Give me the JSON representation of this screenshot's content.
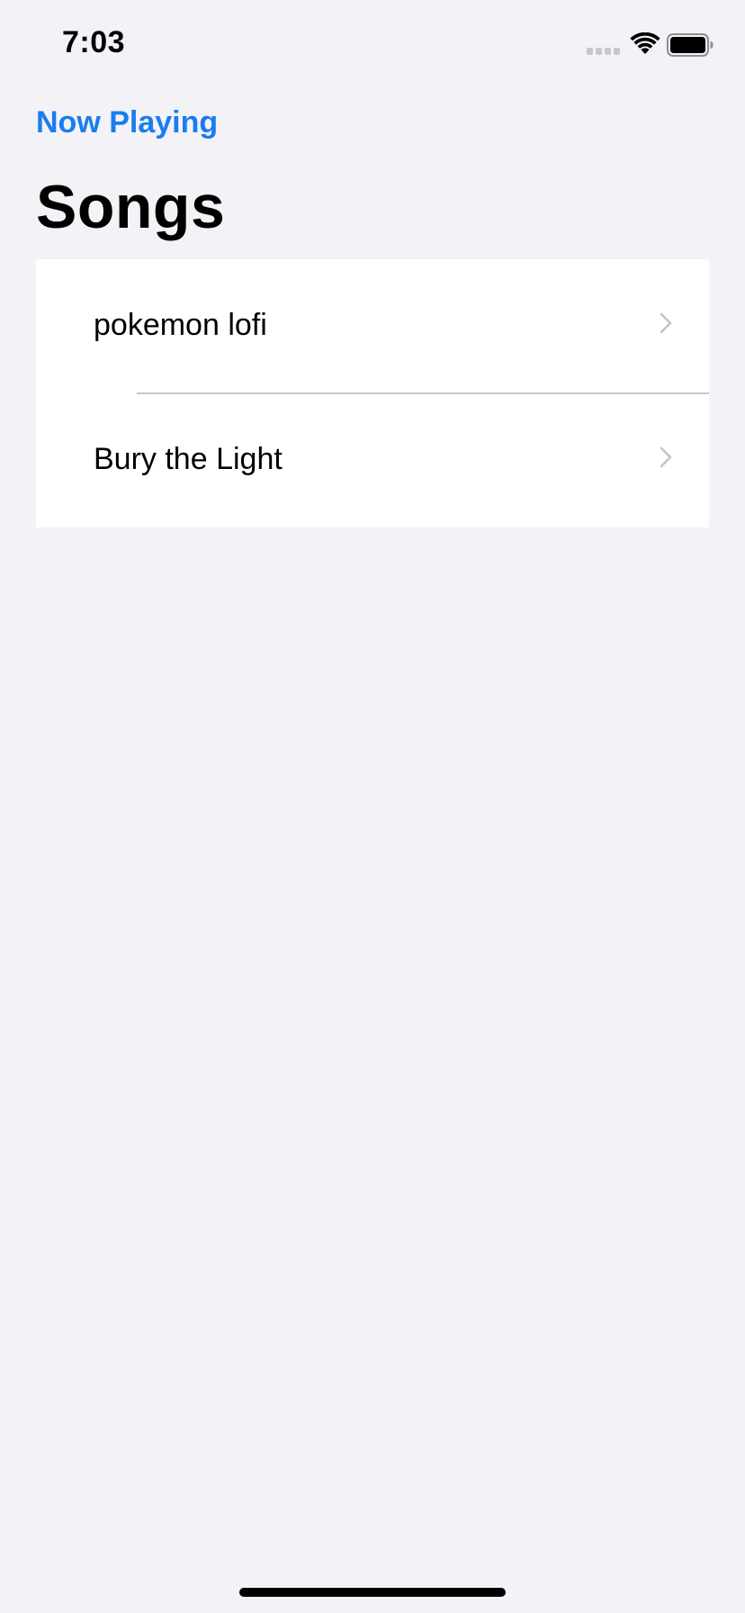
{
  "status_bar": {
    "time": "7:03",
    "signal_icon": "cellular-signal-icon",
    "wifi_icon": "wifi-icon",
    "battery_icon": "battery-icon"
  },
  "navigation": {
    "back_label": "Now Playing",
    "accent_color": "#1a7cf0"
  },
  "page": {
    "title": "Songs"
  },
  "songs": [
    {
      "title": "pokemon lofi",
      "accessory_icon": "chevron-right-icon"
    },
    {
      "title": "Bury the Light",
      "accessory_icon": "chevron-right-icon"
    }
  ]
}
